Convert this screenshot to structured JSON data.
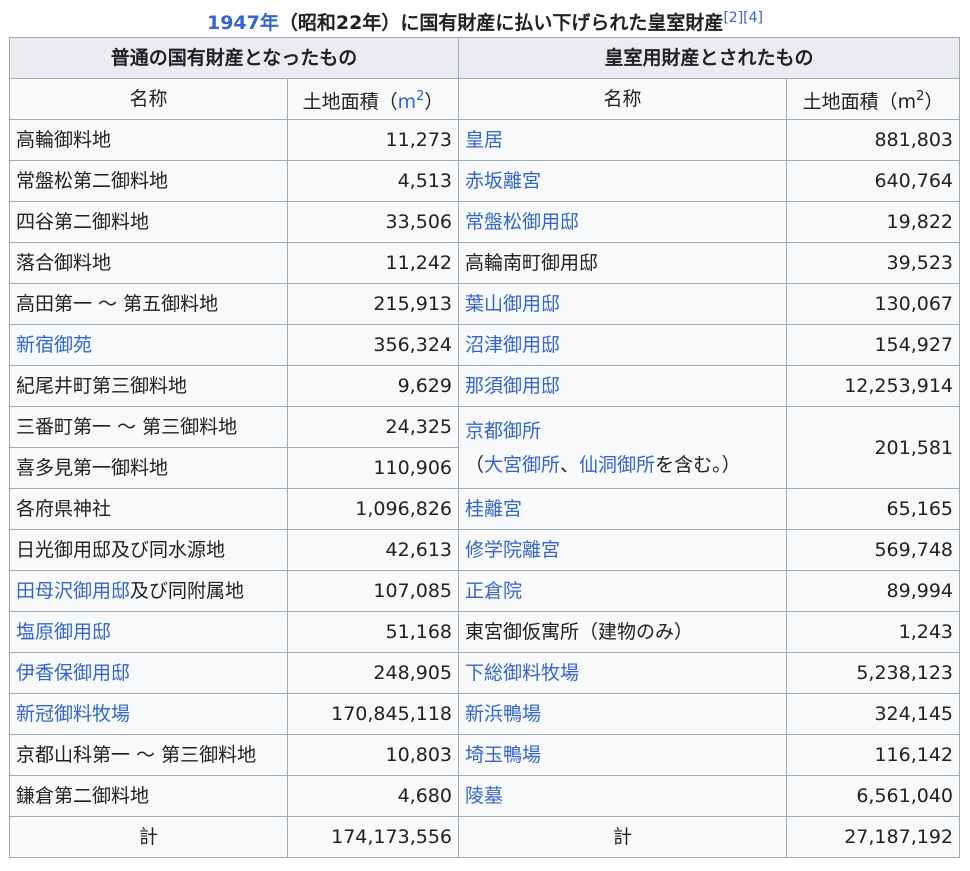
{
  "caption": {
    "year": "1947年",
    "text": "（昭和22年）に国有財産に払い下げられた皇室財産",
    "ref1": "[2]",
    "ref2": "[4]"
  },
  "headers": {
    "left_group": "普通の国有財産となったもの",
    "right_group": "皇室用財産とされたもの",
    "name": "名称",
    "area_left_prefix": "土地面積（",
    "area_left_unit": "m",
    "area_right_prefix": "土地面積（m",
    "sup": "2",
    "close": "）"
  },
  "rows": [
    {
      "left_name": "高輪御料地",
      "left_area": "11,273",
      "right_name": "皇居",
      "right_area": "881,803"
    },
    {
      "left_name": "常盤松第二御料地",
      "left_area": "4,513",
      "right_name": "赤坂離宮",
      "right_area": "640,764"
    },
    {
      "left_name": "四谷第二御料地",
      "left_area": "33,506",
      "right_name": "常盤松御用邸",
      "right_area": "19,822"
    },
    {
      "left_name": "落合御料地",
      "left_area": "11,242",
      "right_name": "高輪南町御用邸",
      "right_area": "39,523"
    },
    {
      "left_name": "高田第一 ～ 第五御料地",
      "left_area": "215,913",
      "right_name": "葉山御用邸",
      "right_area": "130,067"
    },
    {
      "left_name": "新宿御苑",
      "left_area": "356,324",
      "right_name": "沼津御用邸",
      "right_area": "154,927"
    },
    {
      "left_name": "紀尾井町第三御料地",
      "left_area": "9,629",
      "right_name": "那須御用邸",
      "right_area": "12,253,914"
    },
    {
      "left_name": "三番町第一 ～ 第三御料地",
      "left_area": "24,325",
      "right_name": "京都御所",
      "right_area": "201,581",
      "right_note_open": "（",
      "right_note_link1": "大宮御所",
      "right_note_sep": "、",
      "right_note_link2": "仙洞御所",
      "right_note_close": "を含む。）"
    },
    {
      "left_name": "喜多見第一御料地",
      "left_area": "110,906"
    },
    {
      "left_name": "各府県神社",
      "left_area": "1,096,826",
      "right_name": "桂離宮",
      "right_area": "65,165"
    },
    {
      "left_name": "日光御用邸及び同水源地",
      "left_area": "42,613",
      "right_name": "修学院離宮",
      "right_area": "569,748"
    },
    {
      "left_name_link": "田母沢御用邸",
      "left_name_rest": "及び同附属地",
      "left_area": "107,085",
      "right_name": "正倉院",
      "right_area": "89,994"
    },
    {
      "left_name": "塩原御用邸",
      "left_area": "51,168",
      "right_name": "東宮御仮寓所（建物のみ）",
      "right_area": "1,243"
    },
    {
      "left_name": "伊香保御用邸",
      "left_area": "248,905",
      "right_name": "下総御料牧場",
      "right_area": "5,238,123"
    },
    {
      "left_name": "新冠御料牧場",
      "left_area": "170,845,118",
      "right_name": "新浜鴨場",
      "right_area": "324,145"
    },
    {
      "left_name": "京都山科第一 ～ 第三御料地",
      "left_area": "10,803",
      "right_name": "埼玉鴨場",
      "right_area": "116,142"
    },
    {
      "left_name": "鎌倉第二御料地",
      "left_area": "4,680",
      "right_name": "陵墓",
      "right_area": "6,561,040"
    }
  ],
  "totals": {
    "left_label": "計",
    "left_value": "174,173,556",
    "right_label": "計",
    "right_value": "27,187,192"
  },
  "colors": {
    "link": "#3366cc",
    "border": "#a2a9b1",
    "header_bg": "#eaecf0",
    "cell_bg": "#f8f9fa"
  }
}
